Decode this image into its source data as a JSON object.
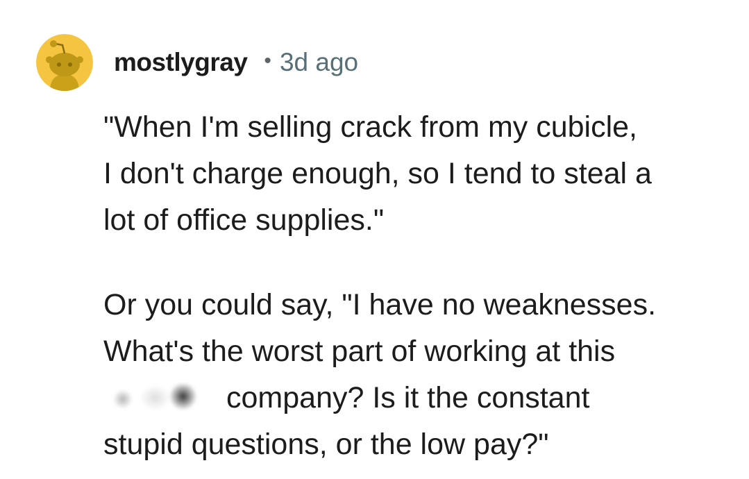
{
  "comment": {
    "username": "mostlygray",
    "separator": "•",
    "timestamp": "3d ago",
    "avatar_icon": "snoo-avatar-icon",
    "avatar_color": "#f5c542",
    "paragraphs": [
      {
        "lines": [
          "\"When I'm selling crack from my cubicle,",
          "I don't charge enough, so I tend to steal a",
          "lot of office supplies.\""
        ]
      },
      {
        "lines": [
          "Or you could say, \"I have no weaknesses.",
          "What's the worst part of working at this"
        ],
        "redacted_line_tail": "company? Is it the constant",
        "last_line": "stupid questions, or the low pay?\""
      }
    ]
  }
}
